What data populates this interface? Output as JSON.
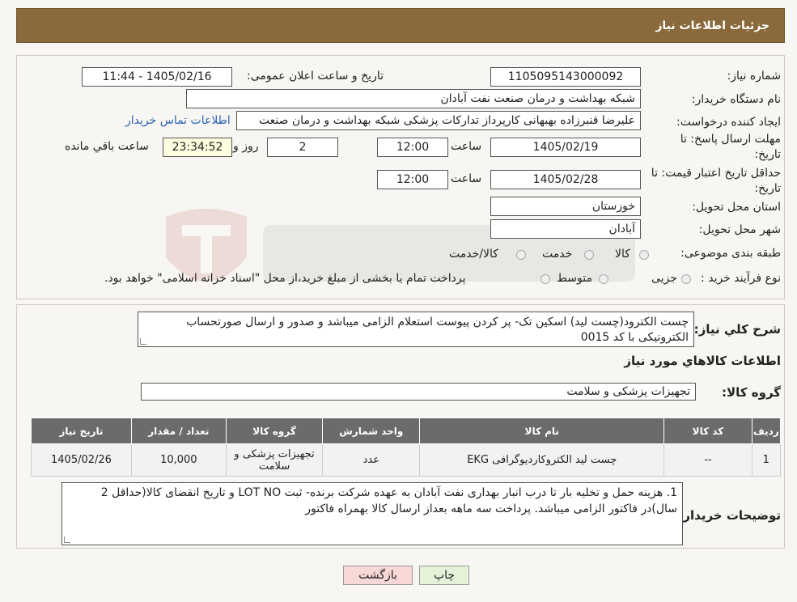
{
  "header": {
    "title": "جزئیات اطلاعات نیاز"
  },
  "form": {
    "need_number_label": "شماره نیاز:",
    "need_number": "1105095143000092",
    "announce_label": "تاریخ و ساعت اعلان عمومی:",
    "announce_value": "1405/02/16 - 11:44",
    "buyer_org_label": "نام دستگاه خریدار:",
    "buyer_org": "شبکه بهداشت و درمان صنعت نفت آبادان",
    "requester_label": "ایجاد کننده درخواست:",
    "requester": "علیرضا قنبرزاده بهبهانی کارپرداز تدارکات پزشکی شبکه بهداشت و درمان صنعت",
    "contact_link": "اطلاعات تماس خریدار",
    "deadline_label_1": "مهلت ارسال پاسخ: تا",
    "deadline_label_2": "تاریخ:",
    "deadline_date": "1405/02/19",
    "time_label": "ساعت",
    "deadline_time": "12:00",
    "days_value": "2",
    "days_label": "روز و",
    "remaining_time": "23:34:52",
    "remaining_label": "ساعت باقي مانده",
    "validity_label_1": "حداقل تاریخ اعتبار قیمت: تا",
    "validity_label_2": "تاریخ:",
    "validity_date": "1405/02/28",
    "validity_time": "12:00",
    "province_label": "استان محل تحویل:",
    "province": "خوزستان",
    "city_label": "شهر محل تحویل:",
    "city": "آبادان",
    "category_label": "طبقه بندی موضوعی:",
    "category_options": [
      "کالا",
      "خدمت",
      "کالا/خدمت"
    ],
    "process_label": "نوع فرآیند خرید :",
    "process_options": [
      "جزیی",
      "متوسط"
    ],
    "process_note": "پرداخت تمام یا بخشی از مبلغ خرید،از محل \"اسناد خزانه اسلامی\" خواهد بود."
  },
  "summary": {
    "label": "شرح کلي نياز:",
    "text": "چست الکترود(چست لید) اسکین تک- پر کردن پیوست استعلام الزامی میباشد و  صدور  و ارسال صورتحساب الکترونیکی با کد 0015",
    "goods_info_title": "اطلاعات کالاهاي مورد نياز",
    "group_label": "گروه کالا:",
    "group_value": "تجهیزات پزشکی و سلامت"
  },
  "table": {
    "headers": [
      "رديف",
      "کد کالا",
      "نام کالا",
      "واحد شمارش",
      "گروه کالا",
      "تعداد / مقدار",
      "تاریخ نیاز"
    ],
    "rows": [
      [
        "1",
        "--",
        "چست لید الکتروکاردیوگرافی EKG",
        "عدد",
        "تجهیزات پزشکی و سلامت",
        "10,000",
        "1405/02/26"
      ]
    ]
  },
  "notes": {
    "label": "توضیحات خریدار:",
    "text": "1.     هزینه حمل و تخلیه بار تا درب انبار بهداری نفت آبادان به عهده شرکت برنده- ثبت LOT NO و تاریخ انقضای کالا(حداقل 2 سال)در فاکتور الزامی میباشد. پرداخت سه ماهه بعداز ارسال کالا بهمراه فاکتور"
  },
  "buttons": {
    "print": "چاپ",
    "back": "بازگشت"
  },
  "colors": {
    "header_bg": "#8a6a3c",
    "table_header_bg": "#6b6b6b",
    "link": "#2a62b8",
    "back_btn": "#f8d7d7",
    "print_btn": "#e3f2d8"
  }
}
